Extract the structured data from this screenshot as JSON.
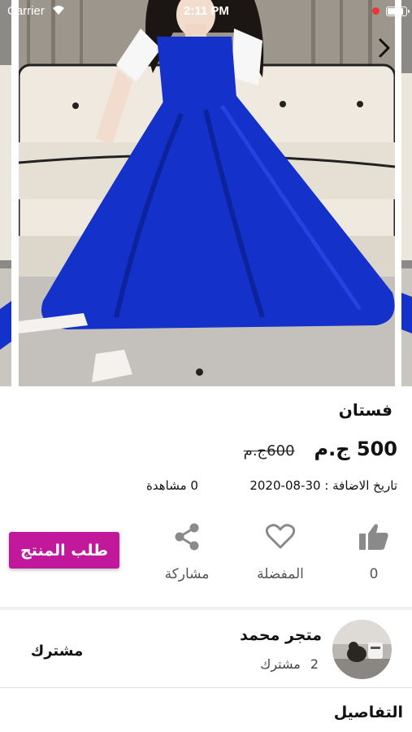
{
  "status_bar": {
    "carrier": "Carrier",
    "time": "2:11 PM"
  },
  "hero": {
    "icons": {
      "next": "chevron-right-icon"
    },
    "active_page": 1
  },
  "product": {
    "title": "فستان",
    "new_price": "500 ج.م",
    "old_price": "600ج.م",
    "views": "0 مشاهدة",
    "date_added": "تاريخ الاضافة : 30-08-2020"
  },
  "actions": {
    "like": {
      "count": "0",
      "icon": "thumbs-up-icon"
    },
    "favorite": {
      "label": "المفضلة",
      "icon": "heart-icon"
    },
    "share": {
      "label": "مشاركة",
      "icon": "share-icon"
    },
    "order_button": "طلب المنتج"
  },
  "store": {
    "name": "متجر محمد",
    "subscribers_count": "2",
    "subscribers_label": "مشترك",
    "subscribe_button": "مشترك"
  },
  "details": {
    "title": "التفاصيل"
  },
  "colors": {
    "accent": "#c2189b",
    "dress": "#1431c9"
  }
}
